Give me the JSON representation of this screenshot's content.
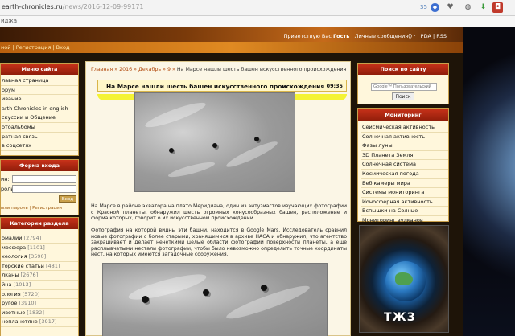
{
  "browser": {
    "domain": "earth-chronicles.ru",
    "path": "/news/2016-12-09-99171",
    "badge": "35",
    "bookmark_label": "иджа"
  },
  "site": {
    "greeting": "Приветствую Вас",
    "user": "Гость",
    "user_links": "| Личные сообщения() · | PDA | RSS",
    "reg_links": "ной | Регистрация | Вход"
  },
  "left": {
    "menu_title": "Меню сайта",
    "menu_items": [
      "лавная страница",
      "орум",
      "ивание",
      "arth Chronicles in english",
      "скуссии и Общение",
      "отоальбомы",
      "ратная связь",
      "в соцсетях"
    ],
    "login_title": "Форма входа",
    "login_label": "ин:",
    "password_label": "роль:",
    "login_button": "Вход",
    "login_links": "ыли пароль | Регистрация",
    "categories_title": "Категории раздела",
    "categories": [
      {
        "name": "омалии",
        "count": "[2794]"
      },
      {
        "name": "мосфера",
        "count": "[1101]"
      },
      {
        "name": "хеология",
        "count": "[3590]"
      },
      {
        "name": "торские статьи",
        "count": "[481]"
      },
      {
        "name": "лканы",
        "count": "[2676]"
      },
      {
        "name": "йна",
        "count": "[1013]"
      },
      {
        "name": "ология",
        "count": "[5720]"
      },
      {
        "name": "ругое",
        "count": "[3910]"
      },
      {
        "name": "ивотные",
        "count": "[1832]"
      },
      {
        "name": "нопланетяне",
        "count": "[3917]"
      }
    ]
  },
  "main": {
    "breadcrumb": {
      "home": "Главная",
      "year": "2016",
      "month": "Декабрь",
      "day": "9",
      "current": "На Марсе нашли шесть башен искусственного происхождения",
      "sep": "»"
    },
    "title": "На Марсе нашли шесть башен искусственного происхождения",
    "time": "09:35",
    "paragraph1": "На Марсе в районе экватора на плато Меридиана, один из энтузиастов изучающих фотографии с Красной планеты, обнаружил шесть огромных конусообразных башен, расположение и форма которых, говорит о их искусственном происхождении.",
    "paragraph2": "Фотография на которой видны эти башни, находится в Google Mars. Исследователь сравнил новые фотографии с более старыми, хранящимися в архиве НАСА и обнаружил, что агентство закрашивает и делает нечеткими целые области фотографий поверхности планеты, а еще расплывчатыми нестали фотографии, чтобы было невозможно определить точные координаты нест, на которых имеются загадочные сооружения."
  },
  "right": {
    "search_title": "Поиск по сайту",
    "search_placeholder": "Google™ Пользовательский",
    "search_button": "Поиск",
    "monitoring_title": "Мониторинг",
    "monitoring_items": [
      "Сейсмическая активность",
      "Солнечная активность",
      "Фазы луны",
      "3D Планета Земля",
      "Солнечная система",
      "Космическая погода",
      "Веб камеры мира",
      "Системы мониторинга",
      "Ионосферная активность",
      "Вспышки на Солнце",
      "Мониторинг вулканов"
    ],
    "banner_text": "ТЖЗ"
  }
}
